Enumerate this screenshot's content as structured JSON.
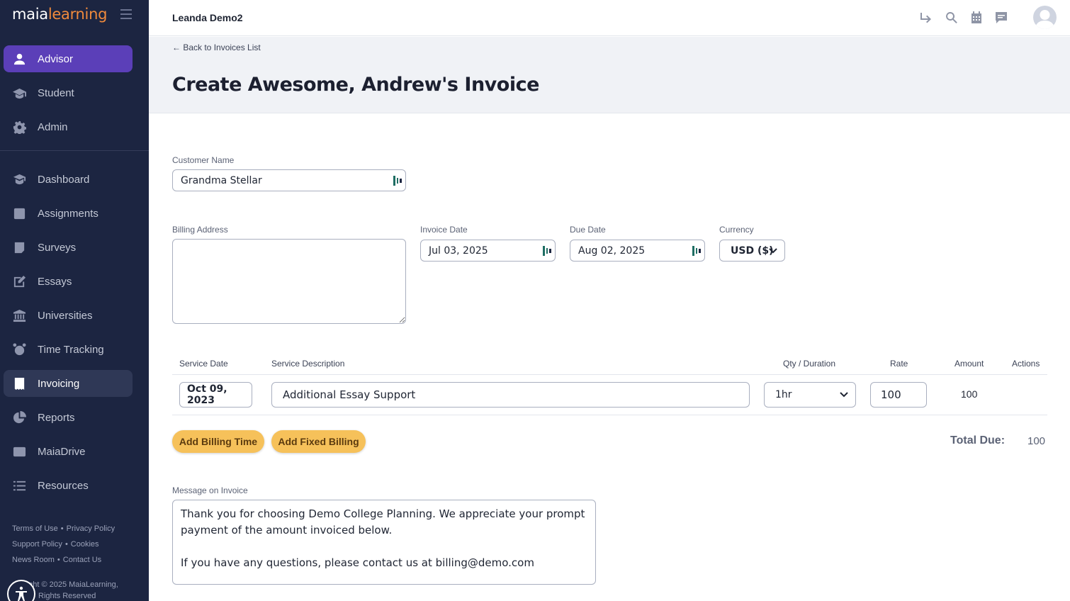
{
  "brand": {
    "maia": "maia",
    "learning": "learning",
    "accent": "#f08a3c"
  },
  "sidebar": {
    "roles": [
      {
        "label": "Advisor",
        "icon": "user-icon",
        "active": true
      },
      {
        "label": "Student",
        "icon": "graduation-cap-icon"
      },
      {
        "label": "Admin",
        "icon": "gear-icon"
      }
    ],
    "items": [
      {
        "label": "Dashboard",
        "icon": "dashboard-icon"
      },
      {
        "label": "Assignments",
        "icon": "assignments-icon"
      },
      {
        "label": "Surveys",
        "icon": "surveys-icon"
      },
      {
        "label": "Essays",
        "icon": "essays-icon"
      },
      {
        "label": "Universities",
        "icon": "university-icon"
      },
      {
        "label": "Time Tracking",
        "icon": "alarm-clock-icon"
      },
      {
        "label": "Invoicing",
        "icon": "invoice-icon",
        "active": true
      },
      {
        "label": "Reports",
        "icon": "pie-chart-icon"
      },
      {
        "label": "MaiaDrive",
        "icon": "drive-icon"
      },
      {
        "label": "Resources",
        "icon": "list-icon"
      }
    ],
    "footer": {
      "terms": "Terms of Use",
      "privacy": "Privacy Policy",
      "support": "Support Policy",
      "cookies": "Cookies",
      "news": "News Room",
      "contact": "Contact Us",
      "copyright_1": "right © 2025 MaiaLearning,",
      "copyright_2": "Rights Reserved"
    }
  },
  "topbar": {
    "org_name": "Leanda Demo2"
  },
  "header": {
    "back_link": "← Back to Invoices List",
    "title": "Create Awesome, Andrew's Invoice"
  },
  "form": {
    "customer_name_label": "Customer Name",
    "customer_name_value": "Grandma Stellar",
    "billing_address_label": "Billing Address",
    "billing_address_value": "",
    "invoice_date_label": "Invoice Date",
    "invoice_date_value": "Jul 03, 2025",
    "due_date_label": "Due Date",
    "due_date_value": "Aug 02, 2025",
    "currency_label": "Currency",
    "currency_value": "USD ($)"
  },
  "table": {
    "headers": {
      "service_date": "Service Date",
      "service_description": "Service Description",
      "qty": "Qty / Duration",
      "rate": "Rate",
      "amount": "Amount",
      "actions": "Actions"
    },
    "rows": [
      {
        "service_date": "Oct 09, 2023",
        "description": "Additional Essay Support",
        "qty": "1hr",
        "rate": "100",
        "amount": "100"
      }
    ]
  },
  "buttons": {
    "add_billing_time": "Add Billing Time",
    "add_fixed_billing": "Add Fixed Billing"
  },
  "totals": {
    "label": "Total Due:",
    "value": "100"
  },
  "message": {
    "label": "Message on Invoice",
    "value": "Thank you for choosing Demo College Planning. We appreciate your prompt payment of the amount invoiced below.\n\nIf you have any questions, please contact us at billing@demo.com"
  }
}
